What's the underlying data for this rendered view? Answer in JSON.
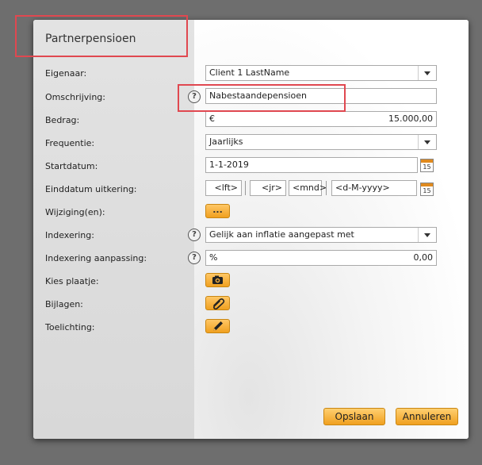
{
  "dialog": {
    "title": "Partnerpensioen"
  },
  "fields": {
    "eigenaar": {
      "label": "Eigenaar:",
      "value": "Client 1 LastName"
    },
    "omschrijving": {
      "label": "Omschrijving:",
      "value": "Nabestaandepensioen"
    },
    "bedrag": {
      "label": "Bedrag:",
      "prefix": "€",
      "value": "15.000,00"
    },
    "frequentie": {
      "label": "Frequentie:",
      "value": "Jaarlijks"
    },
    "startdatum": {
      "label": "Startdatum:",
      "value": "1-1-2019"
    },
    "einddatum": {
      "label": "Einddatum uitkering:",
      "lft": "<lft>",
      "jr": "<jr>",
      "mnd": "<mnd>",
      "date": "<d-M-yyyy>"
    },
    "wijziging": {
      "label": "Wijziging(en):",
      "button": "..."
    },
    "indexering": {
      "label": "Indexering:",
      "value": "Gelijk aan inflatie aangepast met"
    },
    "indexering_aanpassing": {
      "label": "Indexering aanpassing:",
      "prefix": "%",
      "value": "0,00"
    },
    "kies_plaatje": {
      "label": "Kies plaatje:"
    },
    "bijlagen": {
      "label": "Bijlagen:"
    },
    "toelichting": {
      "label": "Toelichting:"
    }
  },
  "calendar_day": "15",
  "help_glyph": "?",
  "buttons": {
    "save": "Opslaan",
    "cancel": "Annuleren"
  },
  "icons": [
    "help-icon",
    "calendar-icon",
    "camera-icon",
    "paperclip-icon",
    "pencil-icon",
    "chevron-down-icon"
  ],
  "colors": {
    "accent": "#f0a020",
    "highlight": "#e04850"
  }
}
